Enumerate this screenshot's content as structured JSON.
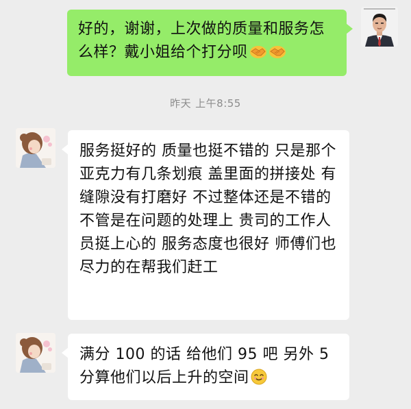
{
  "messages": {
    "outgoing": {
      "text": "好的，谢谢，上次做的质量和服务怎么样？戴小姐给个打分呗",
      "emoji": [
        "handshake-emoji",
        "handshake-emoji"
      ]
    },
    "timestamp": {
      "day": "昨天",
      "time": "上午8:55"
    },
    "incoming_1": {
      "text": "服务挺好的  质量也挺不错的  只是那个亚克力有几条划痕  盖里面的拼接处  有缝隙没有打磨好  不过整体还是不错的  不管是在问题的处理上  贵司的工作人员挺上心的  服务态度也很好 师傅们也尽力的在帮我们赶工"
    },
    "incoming_2": {
      "text": "满分 100 的话  给他们 95 吧  另外 5 分算他们以后上升的空间",
      "emoji": [
        "smiling-face-emoji"
      ]
    }
  },
  "colors": {
    "background": "#ededed",
    "outgoing_bubble": "#95ec69",
    "incoming_bubble": "#ffffff",
    "timestamp_text": "#8c8c8c"
  }
}
